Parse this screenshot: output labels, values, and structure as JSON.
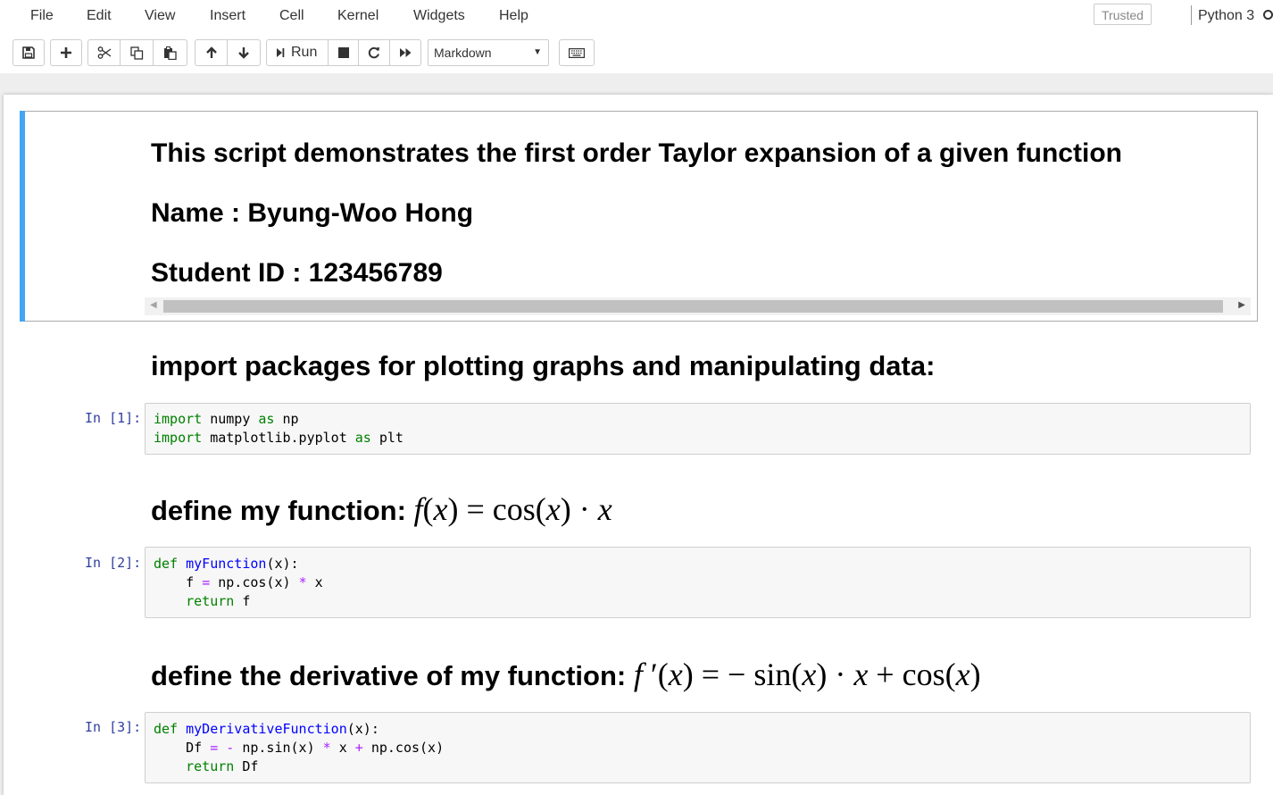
{
  "menubar": {
    "items": [
      "File",
      "Edit",
      "View",
      "Insert",
      "Cell",
      "Kernel",
      "Widgets",
      "Help"
    ],
    "trusted_label": "Trusted",
    "kernel_name": "Python 3"
  },
  "toolbar": {
    "run_label": "Run",
    "cell_type": "Markdown",
    "icons": [
      "save-icon",
      "plus-icon",
      "cut-icon",
      "copy-icon",
      "paste-icon",
      "arrow-up-icon",
      "arrow-down-icon",
      "run-icon",
      "stop-icon",
      "restart-icon",
      "fast-forward-icon",
      "keyboard-icon"
    ]
  },
  "cells": {
    "md1": {
      "title": "This script demonstrates the first order Taylor expansion of a given function",
      "name": "Name : Byung-Woo Hong",
      "student_id": "Student ID : 123456789"
    },
    "md2": {
      "heading": "import packages for plotting graphs and manipulating data:"
    },
    "code1": {
      "prompt": "In [1]:",
      "line1": {
        "kw1": "import",
        "a": " numpy ",
        "kw2": "as",
        "b": " np"
      },
      "line2": {
        "kw1": "import",
        "a": " matplotlib.pyplot ",
        "kw2": "as",
        "b": " plt"
      }
    },
    "md3": {
      "heading": "define my function:",
      "math": {
        "f": "f",
        "lp": "(",
        "x": "x",
        "rp": ") = cos(",
        "x2": "x",
        "rp2": ") · ",
        "x3": "x"
      }
    },
    "code2": {
      "prompt": "In [2]:",
      "line1": {
        "kw": "def",
        "fn": "myFunction",
        "rest": "(x):"
      },
      "line2": {
        "a": "    f ",
        "op1": "=",
        "b": " np.cos(x) ",
        "op2": "*",
        "c": " x"
      },
      "line3": {
        "kw": "    return",
        "rest": " f"
      }
    },
    "md4": {
      "heading": "define the derivative of my function:",
      "math": {
        "f": "f",
        "prime": " ′",
        "lp": "(",
        "x": "x",
        "rp": ") = − sin(",
        "x2": "x",
        "rp2": ") · ",
        "x3": "x",
        "plus": " + cos(",
        "x4": "x",
        "end": ")"
      }
    },
    "code3": {
      "prompt": "In [3]:",
      "line1": {
        "kw": "def",
        "fn": "myDerivativeFunction",
        "rest": "(x):"
      },
      "line2": {
        "a": "    Df ",
        "op1": "=",
        "sp": " ",
        "op2": "-",
        "b": " np.sin(x) ",
        "op3": "*",
        "c": " x ",
        "op4": "+",
        "d": " np.cos(x)"
      },
      "line3": {
        "kw": "    return",
        "rest": " Df"
      }
    }
  },
  "colors": {
    "selected_edge": "#42a5f5",
    "prompt": "#303f9f",
    "keyword": "#008000",
    "function": "#0000ff",
    "operator": "#aa22ff"
  }
}
